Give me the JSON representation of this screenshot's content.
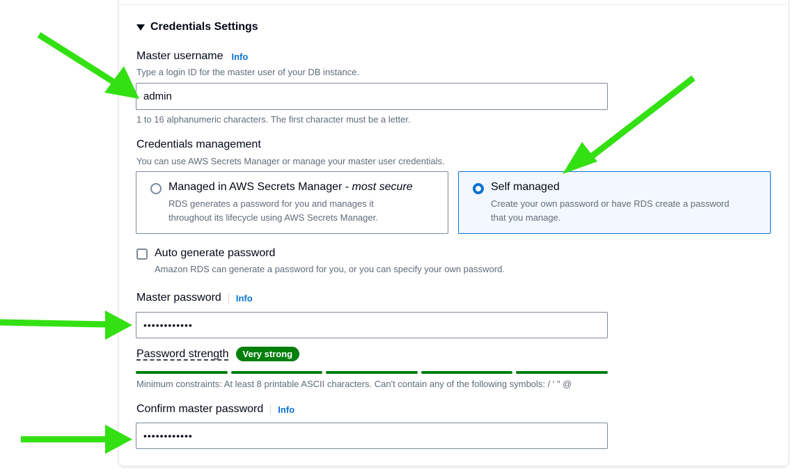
{
  "section": {
    "title": "Credentials Settings"
  },
  "master_username": {
    "label": "Master username",
    "info": "Info",
    "description": "Type a login ID for the master user of your DB instance.",
    "value": "admin",
    "constraint": "1 to 16 alphanumeric characters. The first character must be a letter."
  },
  "credentials_management": {
    "label": "Credentials management",
    "description": "You can use AWS Secrets Manager or manage your master user credentials.",
    "options": [
      {
        "title": "Managed in AWS Secrets Manager - ",
        "title_emphasis": "most secure",
        "description_line1": "RDS generates a password for you and manages it",
        "description_line2": "throughout its lifecycle using AWS Secrets Manager.",
        "selected": false
      },
      {
        "title": "Self managed",
        "description_line1": "Create your own password or have RDS create a password",
        "description_line2": "that you manage.",
        "selected": true
      }
    ]
  },
  "auto_generate": {
    "label": "Auto generate password",
    "description": "Amazon RDS can generate a password for you, or you can specify your own password.",
    "checked": false
  },
  "master_password": {
    "label": "Master password",
    "info": "Info",
    "value": "••••••••••••"
  },
  "password_strength": {
    "label": "Password strength",
    "badge": "Very strong",
    "segments_filled": 5,
    "segments_total": 5,
    "constraint": "Minimum constraints: At least 8 printable ASCII characters. Can't contain any of the following symbols: / ' \" @"
  },
  "confirm_password": {
    "label": "Confirm master password",
    "info": "Info",
    "value": "••••••••••••"
  },
  "colors": {
    "accent": "#0972d3",
    "success": "#037f0c",
    "annotation_arrow": "#33e012"
  }
}
